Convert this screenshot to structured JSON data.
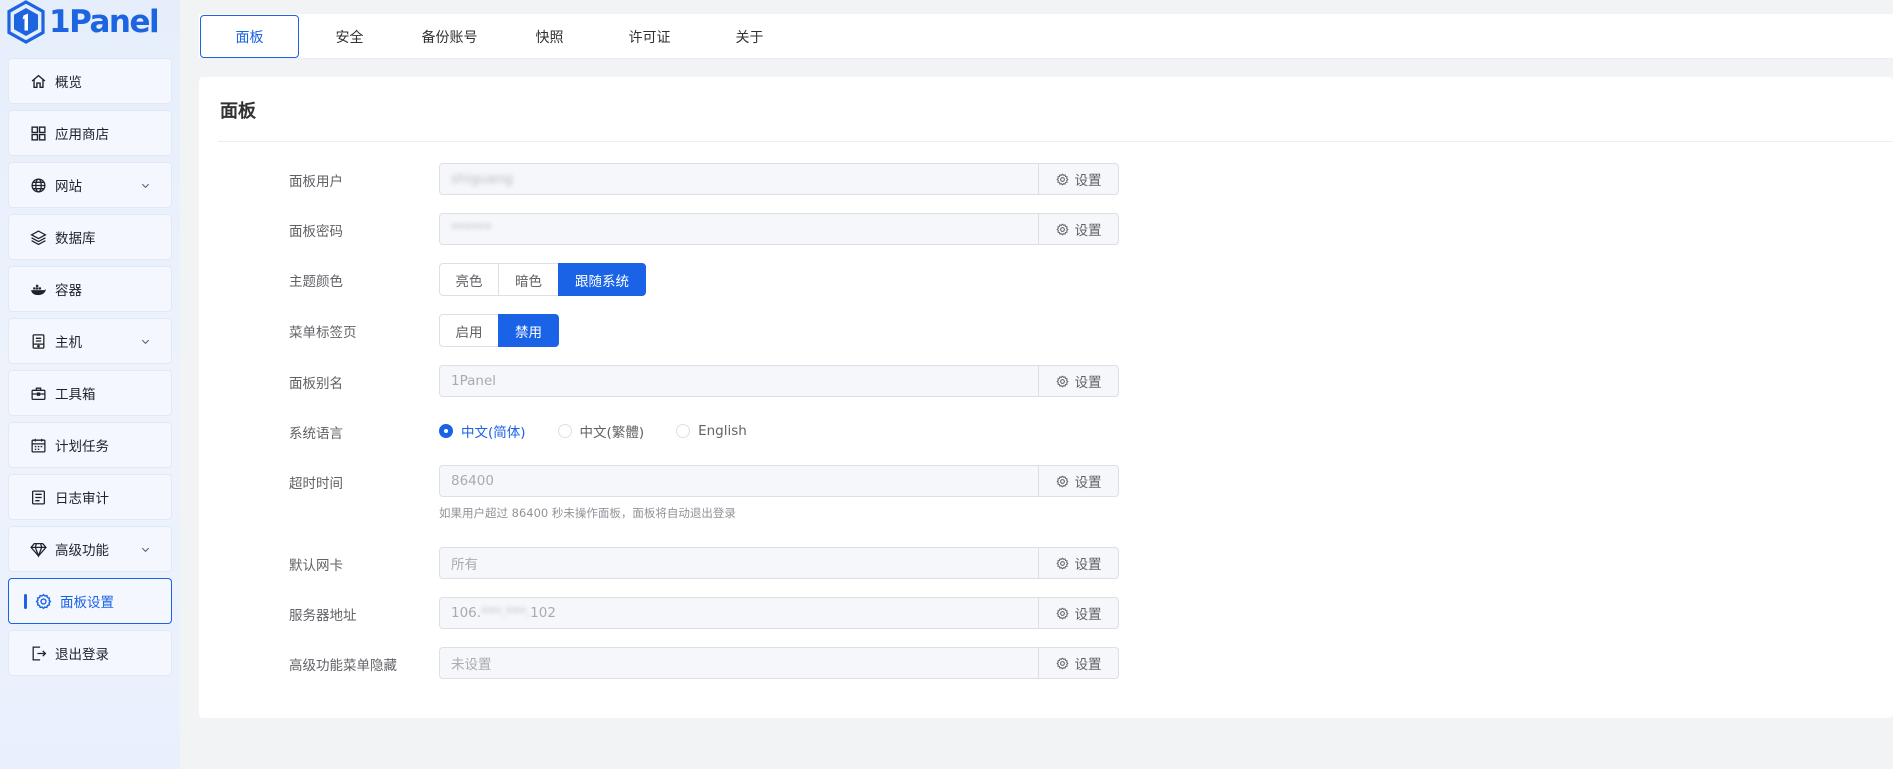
{
  "brand": {
    "name": "1Panel"
  },
  "sidebar": {
    "items": [
      {
        "label": "概览",
        "icon": "home-icon",
        "expandable": false,
        "active": false
      },
      {
        "label": "应用商店",
        "icon": "apps-icon",
        "expandable": false,
        "active": false
      },
      {
        "label": "网站",
        "icon": "globe-icon",
        "expandable": true,
        "active": false
      },
      {
        "label": "数据库",
        "icon": "layers-icon",
        "expandable": false,
        "active": false
      },
      {
        "label": "容器",
        "icon": "docker-icon",
        "expandable": false,
        "active": false
      },
      {
        "label": "主机",
        "icon": "server-icon",
        "expandable": true,
        "active": false
      },
      {
        "label": "工具箱",
        "icon": "toolbox-icon",
        "expandable": false,
        "active": false
      },
      {
        "label": "计划任务",
        "icon": "calendar-icon",
        "expandable": false,
        "active": false
      },
      {
        "label": "日志审计",
        "icon": "log-icon",
        "expandable": false,
        "active": false
      },
      {
        "label": "高级功能",
        "icon": "diamond-icon",
        "expandable": true,
        "active": false
      },
      {
        "label": "面板设置",
        "icon": "gear-icon",
        "expandable": false,
        "active": true
      },
      {
        "label": "退出登录",
        "icon": "logout-icon",
        "expandable": false,
        "active": false
      }
    ]
  },
  "tabs": [
    {
      "label": "面板",
      "active": true
    },
    {
      "label": "安全",
      "active": false
    },
    {
      "label": "备份账号",
      "active": false
    },
    {
      "label": "快照",
      "active": false
    },
    {
      "label": "许可证",
      "active": false
    },
    {
      "label": "关于",
      "active": false
    }
  ],
  "panel": {
    "title": "面板",
    "set_label": "设置",
    "user": {
      "label": "面板用户",
      "value": "shiguang"
    },
    "password": {
      "label": "面板密码",
      "value": "******"
    },
    "theme": {
      "label": "主题颜色",
      "options": [
        "亮色",
        "暗色",
        "跟随系统"
      ],
      "selected": "跟随系统"
    },
    "menu_tabs": {
      "label": "菜单标签页",
      "options": [
        "启用",
        "禁用"
      ],
      "selected": "禁用"
    },
    "alias": {
      "label": "面板别名",
      "value": "1Panel"
    },
    "language": {
      "label": "系统语言",
      "options": [
        "中文(简体)",
        "中文(繁體)",
        "English"
      ],
      "selected": "中文(简体)"
    },
    "timeout": {
      "label": "超时时间",
      "value": "86400",
      "hint": "如果用户超过 86400 秒未操作面板，面板将自动退出登录"
    },
    "nic": {
      "label": "默认网卡",
      "value": "所有"
    },
    "server_addr": {
      "label": "服务器地址",
      "value_prefix": "106.",
      "value_masked": "***.***.",
      "value_suffix": "102"
    },
    "advanced_menu_hide": {
      "label": "高级功能菜单隐藏",
      "value": "未设置"
    }
  },
  "colors": {
    "accent": "#1a62e6",
    "background": "#f2f3f5",
    "panel": "#ffffff"
  }
}
